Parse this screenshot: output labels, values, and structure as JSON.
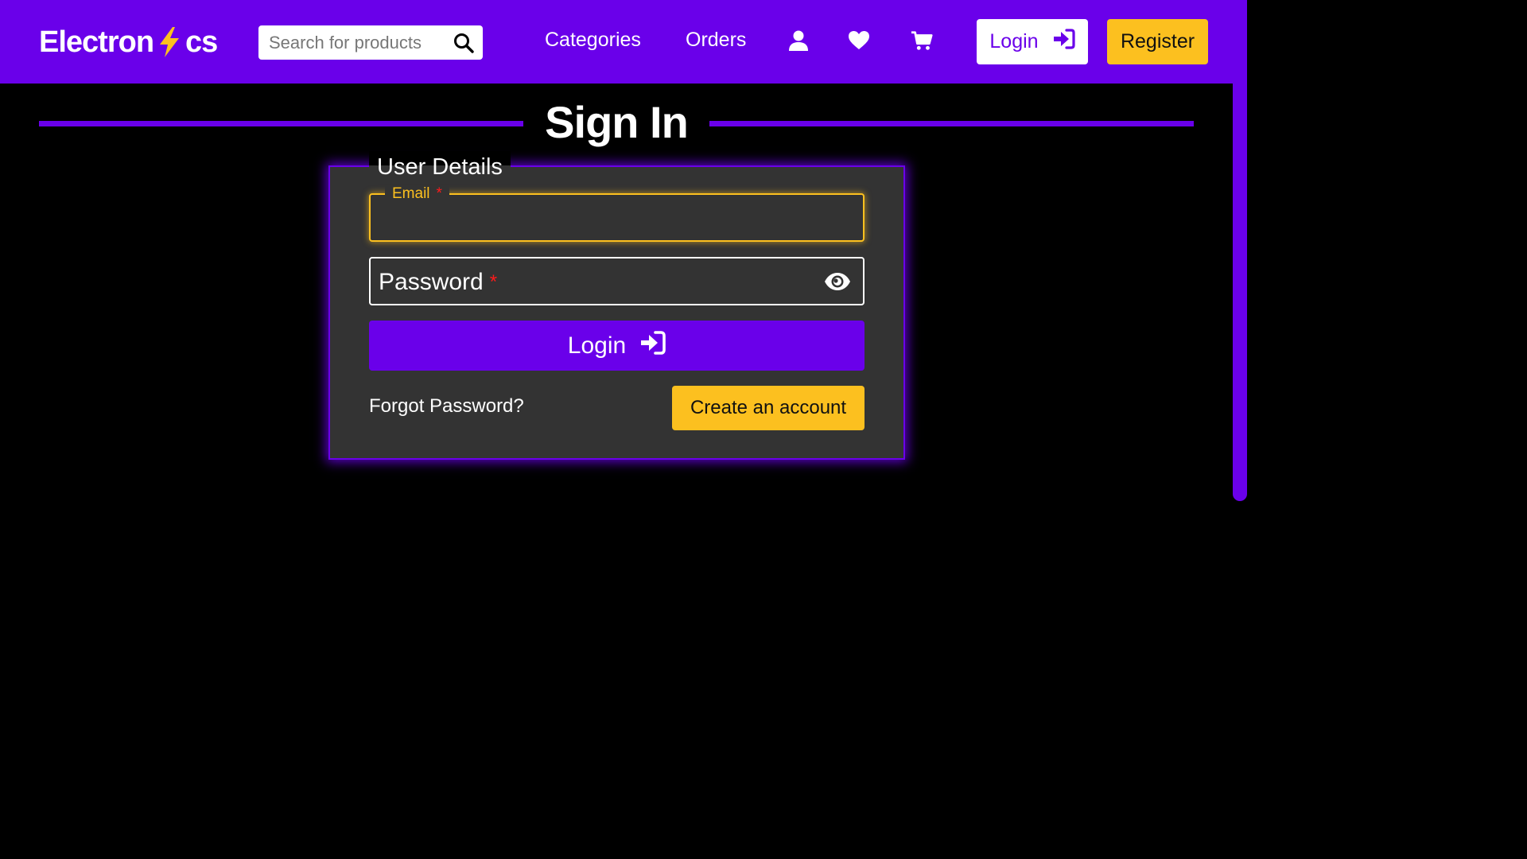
{
  "colors": {
    "brand": "#6a00ea",
    "accent": "#fcc01f",
    "card": "#333333",
    "background": "#000000",
    "required": "#ff1a1a"
  },
  "header": {
    "logo_prefix": "Electron",
    "logo_suffix": "cs",
    "logo_icon": "lightning-bolt-icon",
    "search": {
      "placeholder": "Search for products",
      "icon": "search-icon"
    },
    "nav": {
      "categories": "Categories",
      "orders": "Orders"
    },
    "icons": [
      "user-icon",
      "heart-icon",
      "cart-icon"
    ],
    "login_label": "Login",
    "login_icon": "sign-in-icon",
    "register_label": "Register"
  },
  "page": {
    "title": "Sign In"
  },
  "form": {
    "legend": "User Details",
    "email": {
      "label": "Email",
      "required_mark": "*",
      "value": ""
    },
    "password": {
      "label": "Password",
      "required_mark": "*",
      "value": "",
      "toggle_icon": "eye-icon"
    },
    "login_button": "Login",
    "forgot_password": "Forgot Password?",
    "create_account": "Create an account"
  }
}
